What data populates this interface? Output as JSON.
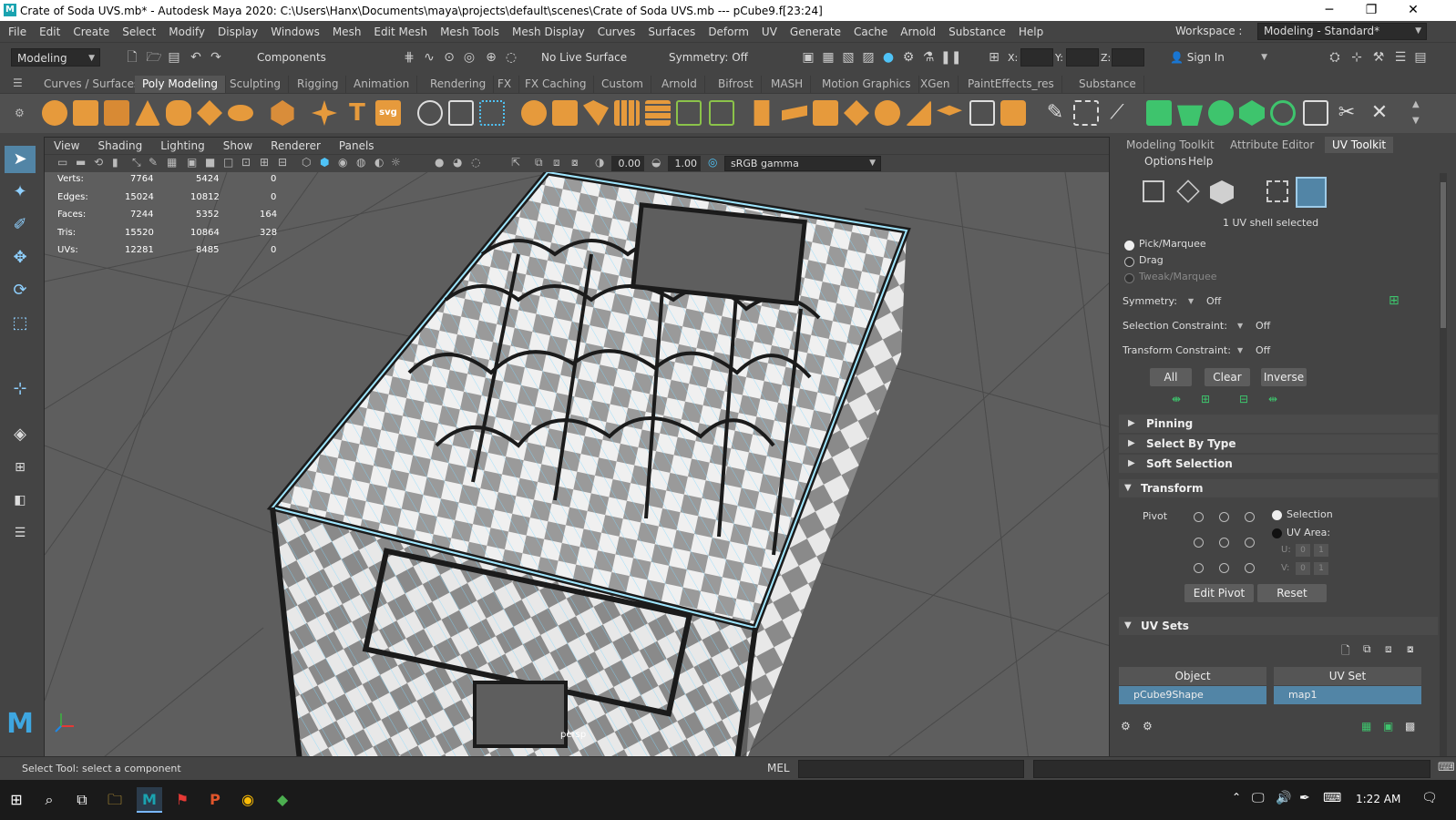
{
  "window": {
    "title": "Crate of Soda UVS.mb* - Autodesk Maya 2020: C:\\Users\\Hanx\\Documents\\maya\\projects\\default\\scenes\\Crate of Soda UVS.mb   ---   pCube9.f[23:24]",
    "minimize": "─",
    "maximize": "❐",
    "close": "✕",
    "logo": "M"
  },
  "menubar": [
    "File",
    "Edit",
    "Create",
    "Select",
    "Modify",
    "Display",
    "Windows",
    "Mesh",
    "Edit Mesh",
    "Mesh Tools",
    "Mesh Display",
    "Curves",
    "Surfaces",
    "Deform",
    "UV",
    "Generate",
    "Cache",
    "Arnold",
    "Substance",
    "Help"
  ],
  "workspace": {
    "label": "Workspace :",
    "value": "Modeling - Standard*"
  },
  "statusline": {
    "menuset": "Modeling",
    "components": "Components",
    "live_surface": "No Live Surface",
    "symmetry": "Symmetry: Off",
    "x_label": "X:",
    "y_label": "Y:",
    "z_label": "Z:",
    "sign_in": "Sign In"
  },
  "shelf_tabs": [
    "Curves / Surfaces",
    "Poly Modeling",
    "Sculpting",
    "Rigging",
    "Animation",
    "Rendering",
    "FX",
    "FX Caching",
    "Custom",
    "Arnold",
    "Bifrost",
    "MASH",
    "Motion Graphics",
    "XGen",
    "PaintEffects_res",
    "Substance"
  ],
  "shelf_active": "Poly Modeling",
  "shelf_icon_text": {
    "type": "T",
    "svg": "svg"
  },
  "viewport": {
    "menus": [
      "View",
      "Shading",
      "Lighting",
      "Show",
      "Renderer",
      "Panels"
    ],
    "exposure": "0.00",
    "gamma": "1.00",
    "colorspace": "sRGB gamma",
    "camera_label": "persp",
    "hud": [
      {
        "label": "Verts:",
        "a": "7764",
        "b": "5424",
        "c": "0"
      },
      {
        "label": "Edges:",
        "a": "15024",
        "b": "10812",
        "c": "0"
      },
      {
        "label": "Faces:",
        "a": "7244",
        "b": "5352",
        "c": "164"
      },
      {
        "label": "Tris:",
        "a": "15520",
        "b": "10864",
        "c": "328"
      },
      {
        "label": "UVs:",
        "a": "12281",
        "b": "8485",
        "c": "0"
      }
    ]
  },
  "right_panel": {
    "tabs": [
      "Modeling Toolkit",
      "Attribute Editor",
      "UV Toolkit"
    ],
    "active_tab": "UV Toolkit",
    "menus": [
      "Options",
      "Help"
    ],
    "shell_status": "1 UV shell selected",
    "modes": [
      "Pick/Marquee",
      "Drag",
      "Tweak/Marquee"
    ],
    "symmetry_label": "Symmetry:",
    "symmetry_value": "Off",
    "sel_constraint_label": "Selection Constraint:",
    "sel_constraint_value": "Off",
    "xform_constraint_label": "Transform Constraint:",
    "xform_constraint_value": "Off",
    "buttons": [
      "All",
      "Clear",
      "Inverse"
    ],
    "sections_collapsed": [
      "Pinning",
      "Select By Type",
      "Soft Selection"
    ],
    "transform_section": "Transform",
    "pivot_label": "Pivot",
    "pivot_selection": "Selection",
    "pivot_uv_area": "UV Area:",
    "u_label": "U:",
    "v_label": "V:",
    "u_values": [
      "0",
      "1"
    ],
    "v_values": [
      "0",
      "1"
    ],
    "edit_pivot": "Edit Pivot",
    "reset": "Reset",
    "uvsets_section": "UV Sets",
    "uvsets_headers": [
      "Object",
      "UV Set"
    ],
    "uvsets_row": [
      "pCube9Shape",
      "map1"
    ]
  },
  "helpline": "Select Tool: select a component",
  "cmdline": {
    "lang": "MEL"
  },
  "taskbar": {
    "time": "1:22 AM"
  },
  "colors": {
    "accent": "#5285a6",
    "highlight_blue": "#4a90c2",
    "maya_teal": "#1aa3b0"
  }
}
